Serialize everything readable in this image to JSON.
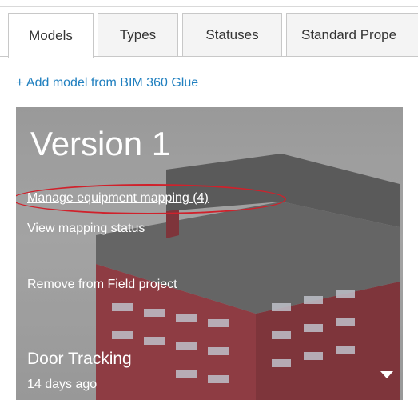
{
  "tabs": [
    {
      "label": "Models",
      "active": true
    },
    {
      "label": "Types",
      "active": false
    },
    {
      "label": "Statuses",
      "active": false
    },
    {
      "label": "Standard Prope",
      "active": false
    }
  ],
  "add_model_link": "+ Add model from BIM 360 Glue",
  "card": {
    "title": "Version 1",
    "links": {
      "manage_mapping": "Manage equipment mapping (4)",
      "view_status": "View mapping status",
      "remove": "Remove from Field project"
    },
    "name": "Door Tracking",
    "date": "14 days ago",
    "highlighted_item": "Manage equipment mapping (4)",
    "icons": {
      "dropdown": "chevron-down-icon"
    }
  },
  "colors": {
    "link": "#1f7fbf",
    "highlight": "#d0212b",
    "building_wall": "#8e2a33",
    "building_roof": "#5a5a5a"
  }
}
